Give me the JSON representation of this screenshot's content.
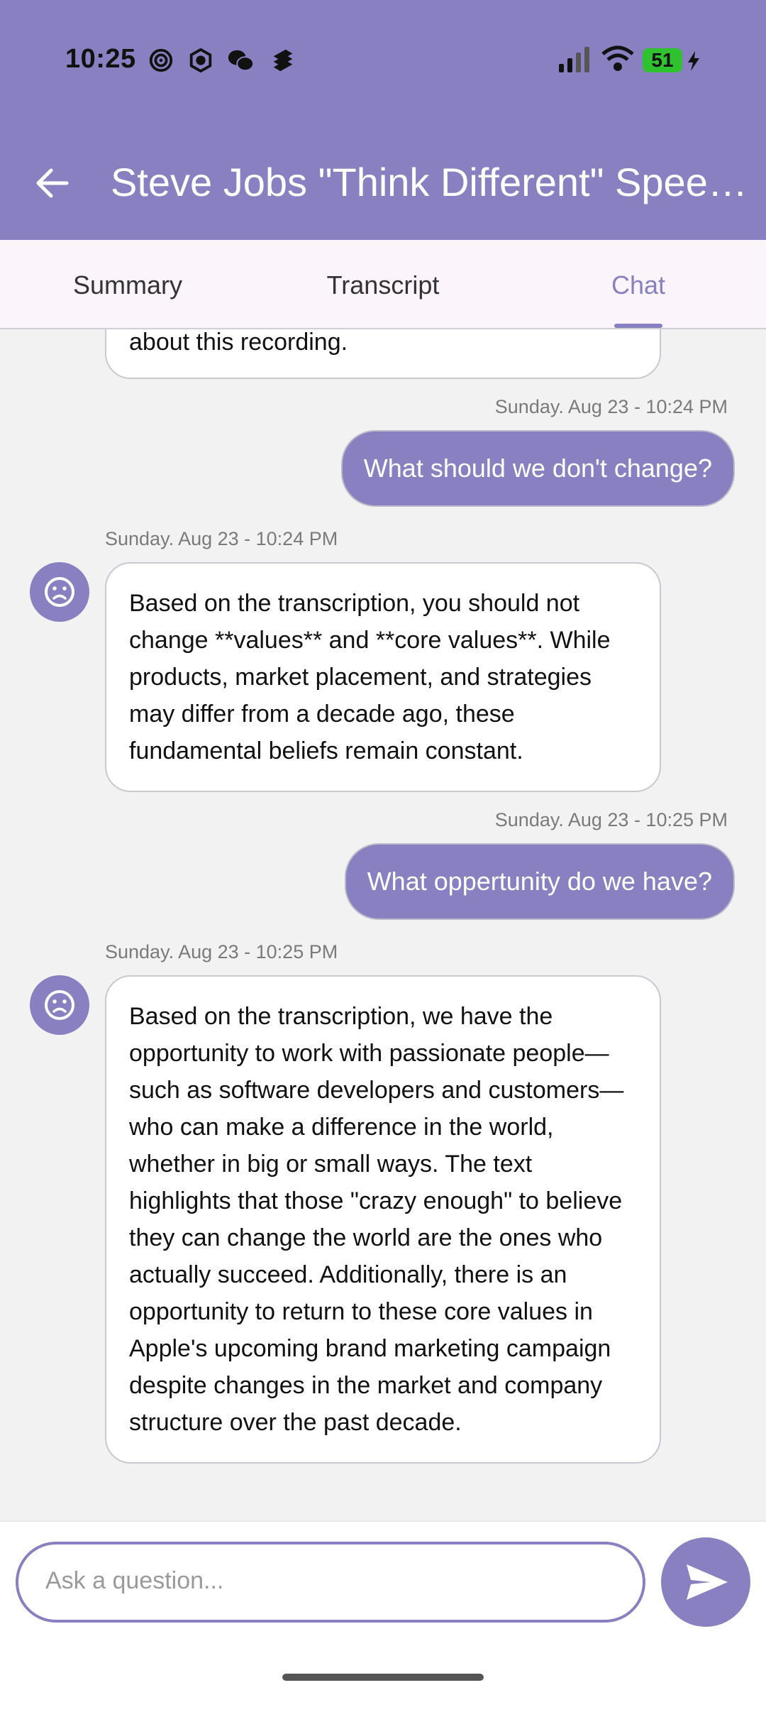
{
  "status_bar": {
    "time": "10:25",
    "battery": "51"
  },
  "header": {
    "title": "Steve Jobs \"Think Different\" Spee…"
  },
  "tabs": [
    {
      "label": "Summary"
    },
    {
      "label": "Transcript"
    },
    {
      "label": "Chat"
    }
  ],
  "chat": {
    "partial_ai_text": "about this recording.",
    "messages": [
      {
        "timestamp": "Sunday. Aug 23 - 10:24 PM",
        "text": "What should we don't change?"
      },
      {
        "timestamp": "Sunday. Aug 23 - 10:24 PM",
        "text": "Based on the transcription, you should not change **values** and **core values**. While products, market placement, and strategies may differ from a decade ago, these fundamental beliefs remain constant."
      },
      {
        "timestamp": "Sunday. Aug 23 - 10:25 PM",
        "text": "What oppertunity do we have?"
      },
      {
        "timestamp": "Sunday. Aug 23 - 10:25 PM",
        "text": "Based on the transcription, we have the opportunity to work with passionate people—such as software developers and customers—who can make a difference in the world, whether in big or small ways. The text highlights that those \"crazy enough\" to believe they can change the world are the ones who actually succeed. Additionally, there is an opportunity to return to these core values in Apple's upcoming brand marketing campaign despite changes in the market and company structure over the past decade."
      }
    ]
  },
  "input": {
    "placeholder": "Ask a question..."
  },
  "icons": {
    "back": "arrow-left-icon",
    "avatar": "sad-face-icon",
    "send": "send-icon"
  },
  "colors": {
    "primary": "#8880c0",
    "tab_bg": "#fbf5fb",
    "chat_bg": "#f2f2f2"
  }
}
